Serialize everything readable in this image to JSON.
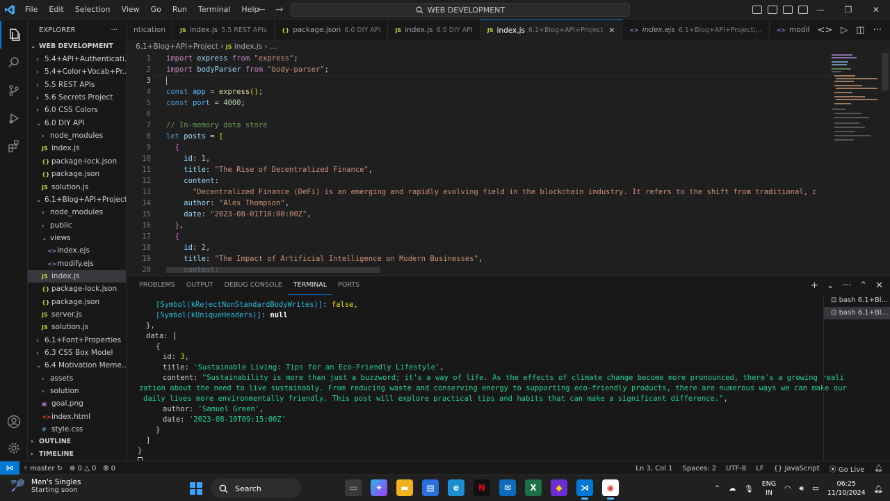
{
  "menu": [
    "File",
    "Edit",
    "Selection",
    "View",
    "Go",
    "Run",
    "Terminal",
    "Help"
  ],
  "command_center": "WEB DEVELOPMENT",
  "explorer": {
    "title": "EXPLORER",
    "root": "WEB DEVELOPMENT",
    "items": [
      {
        "label": "5.4+API+Authenticati...",
        "kind": "folder",
        "open": false,
        "indent": 1
      },
      {
        "label": "5.4+Color+Vocab+Pr...",
        "kind": "folder",
        "open": false,
        "indent": 1
      },
      {
        "label": "5.5 REST APIs",
        "kind": "folder",
        "open": false,
        "indent": 1
      },
      {
        "label": "5.6 Secrets Project",
        "kind": "folder",
        "open": false,
        "indent": 1
      },
      {
        "label": "6.0 CSS Colors",
        "kind": "folder",
        "open": false,
        "indent": 1
      },
      {
        "label": "6.0 DIY API",
        "kind": "folder",
        "open": true,
        "indent": 1
      },
      {
        "label": "node_modules",
        "kind": "folder",
        "open": false,
        "indent": 2
      },
      {
        "label": "index.js",
        "kind": "js",
        "indent": 2
      },
      {
        "label": "package-lock.json",
        "kind": "json",
        "indent": 2
      },
      {
        "label": "package.json",
        "kind": "json",
        "indent": 2
      },
      {
        "label": "solution.js",
        "kind": "js",
        "indent": 2
      },
      {
        "label": "6.1+Blog+API+Project",
        "kind": "folder",
        "open": true,
        "indent": 1
      },
      {
        "label": "node_modules",
        "kind": "folder",
        "open": false,
        "indent": 2
      },
      {
        "label": "public",
        "kind": "folder",
        "open": false,
        "indent": 2
      },
      {
        "label": "views",
        "kind": "folder",
        "open": true,
        "indent": 2
      },
      {
        "label": "index.ejs",
        "kind": "ejs",
        "indent": 3
      },
      {
        "label": "modify.ejs",
        "kind": "ejs",
        "indent": 3
      },
      {
        "label": "index.js",
        "kind": "js",
        "indent": 2,
        "selected": true
      },
      {
        "label": "package-lock.json",
        "kind": "json",
        "indent": 2
      },
      {
        "label": "package.json",
        "kind": "json",
        "indent": 2
      },
      {
        "label": "server.js",
        "kind": "js",
        "indent": 2
      },
      {
        "label": "solution.js",
        "kind": "js",
        "indent": 2
      },
      {
        "label": "6.1+Font+Properties",
        "kind": "folder",
        "open": false,
        "indent": 1
      },
      {
        "label": "6.3 CSS Box Model",
        "kind": "folder",
        "open": false,
        "indent": 1
      },
      {
        "label": "6.4 Motivation Meme...",
        "kind": "folder",
        "open": true,
        "indent": 1
      },
      {
        "label": "assets",
        "kind": "folder",
        "open": false,
        "indent": 2
      },
      {
        "label": "solution",
        "kind": "folder",
        "open": false,
        "indent": 2
      },
      {
        "label": "goal.png",
        "kind": "png",
        "indent": 2
      },
      {
        "label": "index.html",
        "kind": "html",
        "indent": 2
      },
      {
        "label": "style.css",
        "kind": "css",
        "indent": 2
      }
    ],
    "outline": "OUTLINE",
    "timeline": "TIMELINE"
  },
  "tabs": [
    {
      "name": "ntication",
      "dim": "",
      "icon": ""
    },
    {
      "name": "index.js",
      "dim": "5.5 REST APIs",
      "icon": "JS"
    },
    {
      "name": "package.json",
      "dim": "6.0 DIY API",
      "icon": "{}"
    },
    {
      "name": "index.js",
      "dim": "6.0 DIY API",
      "icon": "JS"
    },
    {
      "name": "index.js",
      "dim": "6.1+Blog+API+Project",
      "icon": "JS",
      "active": true
    },
    {
      "name": "index.ejs",
      "dim": "6.1+Blog+API+Project\\...",
      "icon": "<>"
    },
    {
      "name": "modify.ejs",
      "dim": "",
      "icon": "<>"
    }
  ],
  "breadcrumb": {
    "folder": "6.1+Blog+API+Project",
    "file": "index.js",
    "rest": "..."
  },
  "editor": {
    "current_line": 3,
    "lines": [
      1,
      2,
      3,
      4,
      5,
      6,
      7,
      8,
      9,
      10,
      11,
      12,
      13,
      14,
      15,
      16,
      17,
      18,
      19,
      20
    ]
  },
  "panel": {
    "tabs": [
      "PROBLEMS",
      "OUTPUT",
      "DEBUG CONSOLE",
      "TERMINAL",
      "PORTS"
    ],
    "active": "TERMINAL",
    "terminals": [
      "bash  6.1+Bl...",
      "bash  6.1+Bl..."
    ]
  },
  "statusbar": {
    "branch": "master",
    "errors": "0",
    "warnings": "0",
    "ports": "0",
    "position": "Ln 3, Col 1",
    "spaces": "Spaces: 2",
    "encoding": "UTF-8",
    "eol": "LF",
    "language": "JavaScript",
    "golive": "Go Live"
  },
  "taskbar": {
    "weather_title": "Men's Singles",
    "weather_sub": "Starting soon",
    "search": "Search",
    "lang": "ENG",
    "region": "IN",
    "time": "06:25",
    "date": "11/10/2024"
  },
  "colors": {
    "accent": "#0078d4",
    "activity_bg": "#181818",
    "editor_bg": "#1f1f1f"
  }
}
